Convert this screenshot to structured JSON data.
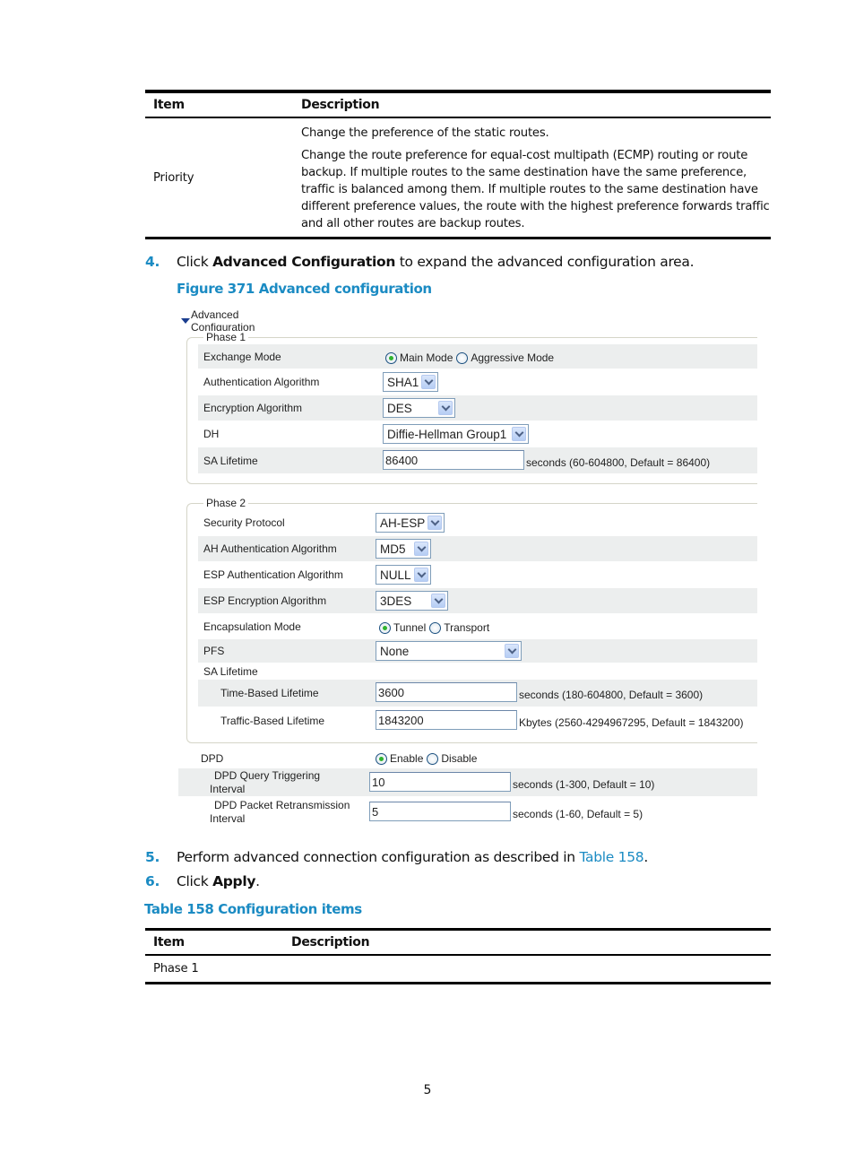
{
  "table_top": {
    "headers": [
      "Item",
      "Description"
    ],
    "rows": [
      {
        "item": "Priority",
        "description": [
          "Change the preference of the static routes.",
          "Change the route preference for equal-cost multipath (ECMP) routing or route backup. If multiple routes to the same destination have the same preference, traffic is balanced among them. If multiple routes to the same destination have different preference values, the route with the highest preference forwards traffic and all other routes are backup routes."
        ]
      }
    ]
  },
  "step4": {
    "num": "4.",
    "pre": "Click ",
    "bold": "Advanced Configuration",
    "post": " to expand the advanced configuration area."
  },
  "figure_caption": "Figure 371 Advanced configuration",
  "figure": {
    "toggle_label": "Advanced Configuration",
    "phase1": {
      "legend": "Phase 1",
      "exchange_mode": {
        "label": "Exchange Mode",
        "options": [
          "Main Mode",
          "Aggressive Mode"
        ],
        "selected": "Main Mode"
      },
      "auth_alg": {
        "label": "Authentication Algorithm",
        "value": "SHA1"
      },
      "enc_alg": {
        "label": "Encryption Algorithm",
        "value": "DES"
      },
      "dh": {
        "label": "DH",
        "value": "Diffie-Hellman Group1"
      },
      "sa_lifetime": {
        "label": "SA Lifetime",
        "value": "86400",
        "hint": "seconds (60-604800, Default = 86400)"
      }
    },
    "phase2": {
      "legend": "Phase 2",
      "security_protocol": {
        "label": "Security Protocol",
        "value": "AH-ESP"
      },
      "ah_auth": {
        "label": "AH Authentication Algorithm",
        "value": "MD5"
      },
      "esp_auth": {
        "label": "ESP Authentication Algorithm",
        "value": "NULL"
      },
      "esp_enc": {
        "label": "ESP Encryption Algorithm",
        "value": "3DES"
      },
      "encap_mode": {
        "label": "Encapsulation Mode",
        "options": [
          "Tunnel",
          "Transport"
        ],
        "selected": "Tunnel"
      },
      "pfs": {
        "label": "PFS",
        "value": "None"
      },
      "sa_lifetime_label": "SA Lifetime",
      "time_lifetime": {
        "label": "Time-Based Lifetime",
        "value": "3600",
        "hint": "seconds (180-604800, Default = 3600)"
      },
      "traffic_lifetime": {
        "label": "Traffic-Based Lifetime",
        "value": "1843200",
        "hint": "Kbytes (2560-4294967295, Default = 1843200)"
      }
    },
    "dpd": {
      "label": "DPD",
      "options": [
        "Enable",
        "Disable"
      ],
      "selected": "Enable",
      "query_interval": {
        "label_line1": "DPD Query Triggering",
        "label_line2": "Interval",
        "value": "10",
        "hint": "seconds (1-300, Default = 10)"
      },
      "retrans_interval": {
        "label_line1": "DPD Packet Retransmission",
        "label_line2": "Interval",
        "value": "5",
        "hint": "seconds (1-60, Default = 5)"
      }
    }
  },
  "step5": {
    "num": "5.",
    "pre": "Perform advanced connection configuration as described in ",
    "link": "Table 158",
    "post": "."
  },
  "step6": {
    "num": "6.",
    "pre": "Click ",
    "bold": "Apply",
    "post": "."
  },
  "table_caption": "Table 158 Configuration items",
  "table_bottom": {
    "headers": [
      "Item",
      "Description"
    ],
    "rows": [
      {
        "item": "Phase 1",
        "description": ""
      }
    ]
  },
  "page_number": "5",
  "colors": {
    "accent_blue": "#1b8bc3",
    "row_shade": "#eceeee",
    "input_border": "#7f9db9"
  }
}
